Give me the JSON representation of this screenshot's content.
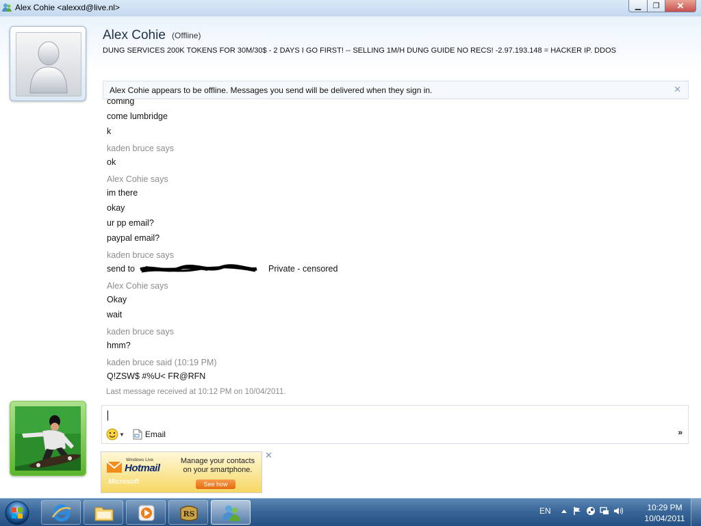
{
  "window": {
    "title": "Alex Cohie <alexxd@live.nl>",
    "minimize": "▁",
    "maximize": "❐",
    "close": "✕"
  },
  "contact": {
    "name": "Alex Cohie",
    "status": "(Offline)",
    "personal_message": "DUNG SERVICES 200K TOKENS FOR 30M/30$ - 2 DAYS I GO FIRST! -- SELLING 1M/H DUNG GUIDE NO RECS!   -2.97.193.148 = HACKER IP. DDOS"
  },
  "notice": {
    "text": "Alex Cohie appears to be offline. Messages you send will be delivered when they sign in.",
    "close": "✕"
  },
  "conversation": {
    "first_block": [
      "coming",
      "come lumbridge",
      "k"
    ],
    "block2": {
      "says": "kaden bruce says",
      "lines": [
        "ok"
      ]
    },
    "block3": {
      "says": "Alex Cohie says",
      "lines": [
        "im there",
        "okay",
        "ur pp email?",
        "paypal email?"
      ]
    },
    "block4": {
      "says": "kaden bruce says",
      "prefix": "send to",
      "censored": "Private - censored"
    },
    "block5": {
      "says": "Alex Cohie says",
      "lines": [
        "Okay",
        "wait"
      ]
    },
    "block6": {
      "says": "kaden bruce says",
      "lines": [
        "hmm?"
      ]
    },
    "block7": {
      "says": "kaden bruce said (10:19 PM)",
      "lines": [
        "Q!ZSW$ #%U< FR@RFN"
      ]
    }
  },
  "last_received": "Last message received at 10:12 PM on 10/04/2011.",
  "compose": {
    "value": "",
    "email_label": "Email",
    "more": "»"
  },
  "ad": {
    "brand_small": "Windows Live",
    "brand": "Hotmail",
    "copy": "Manage your contacts on your smartphone.",
    "cta": "See how",
    "microsoft": "Microsoft",
    "close": "✕"
  },
  "taskbar": {
    "language": "EN",
    "time": "10:29 PM",
    "date": "10/04/2011"
  }
}
